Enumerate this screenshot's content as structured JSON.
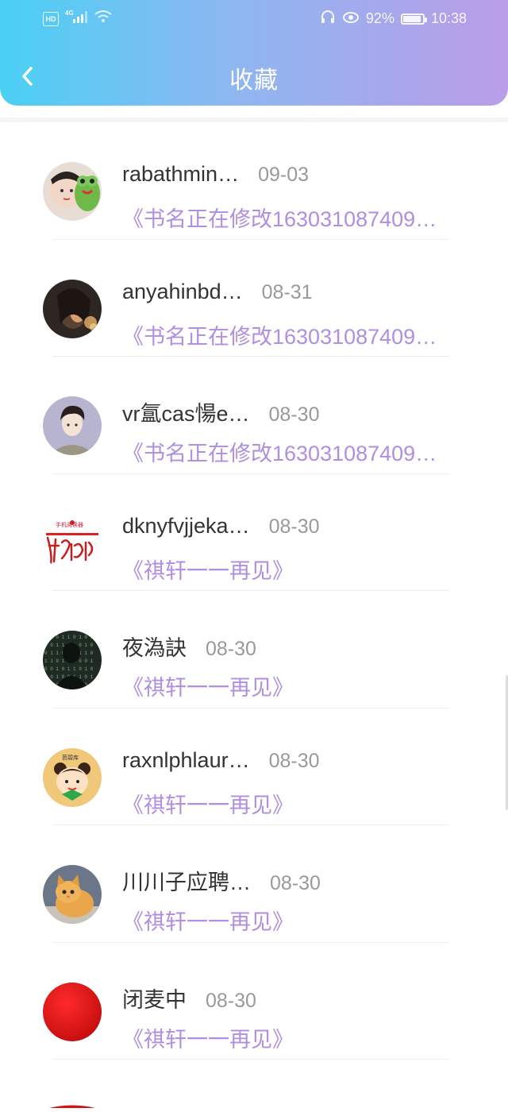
{
  "status_bar": {
    "hd": "HD",
    "network": "4G",
    "battery": "92%",
    "battery_level": 0.92,
    "time": "10:38"
  },
  "header": {
    "title": "收藏",
    "back_icon": "chevron-left-icon"
  },
  "colors": {
    "header_gradient_start": "#4ad0f4",
    "header_gradient_end": "#b99de8",
    "book_title": "#b08ee0",
    "name": "#333333",
    "date": "#999999"
  },
  "items": [
    {
      "name": "rabathmin…",
      "date": "09-03",
      "book": "《书名正在修改163031087409…",
      "avatar": "avatar-girl-with-frog"
    },
    {
      "name": "anyahinbd…",
      "date": "08-31",
      "book": "《书名正在修改163031087409…",
      "avatar": "avatar-dark-portrait"
    },
    {
      "name": "vr氲cas愓e…",
      "date": "08-30",
      "book": "《书名正在修改163031087409…",
      "avatar": "avatar-young-man"
    },
    {
      "name": "dknyfvjjeka…",
      "date": "08-30",
      "book": "《祺轩一一再见》",
      "avatar": "avatar-handwriting-logo"
    },
    {
      "name": "夜溈訣",
      "date": "08-30",
      "book": "《祺轩一一再见》",
      "avatar": "avatar-matrix-figure"
    },
    {
      "name": "raxnlphlaur…",
      "date": "08-30",
      "book": "《祺轩一一再见》",
      "avatar": "avatar-cartoon-girl"
    },
    {
      "name": "川川子应聘…",
      "date": "08-30",
      "book": "《祺轩一一再见》",
      "avatar": "avatar-orange-kitten"
    },
    {
      "name": "闭麦中",
      "date": "08-30",
      "book": "《祺轩一一再见》",
      "avatar": "avatar-red-circle"
    }
  ]
}
